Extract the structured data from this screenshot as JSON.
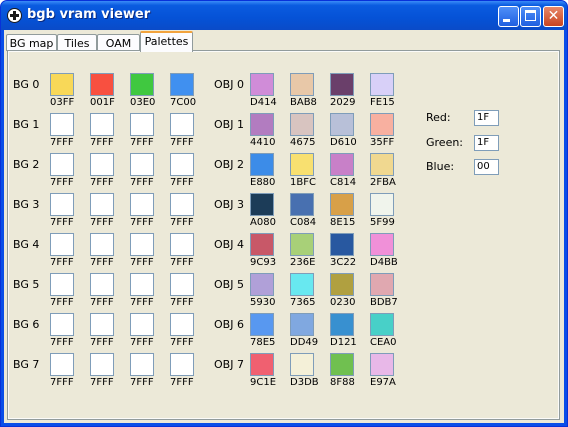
{
  "window": {
    "title": "bgb vram viewer"
  },
  "tabs": [
    {
      "label": "BG map",
      "active": false
    },
    {
      "label": "Tiles",
      "active": false
    },
    {
      "label": "OAM",
      "active": false
    },
    {
      "label": "Palettes",
      "active": true
    }
  ],
  "bg_palettes": [
    {
      "label": "BG 0",
      "colors": [
        {
          "code": "03FF",
          "hex": "#f8d858"
        },
        {
          "code": "001F",
          "hex": "#f85040"
        },
        {
          "code": "03E0",
          "hex": "#40c840"
        },
        {
          "code": "7C00",
          "hex": "#4090f0"
        }
      ]
    },
    {
      "label": "BG 1",
      "colors": [
        {
          "code": "7FFF",
          "hex": "#ffffff"
        },
        {
          "code": "7FFF",
          "hex": "#ffffff"
        },
        {
          "code": "7FFF",
          "hex": "#ffffff"
        },
        {
          "code": "7FFF",
          "hex": "#ffffff"
        }
      ]
    },
    {
      "label": "BG 2",
      "colors": [
        {
          "code": "7FFF",
          "hex": "#ffffff"
        },
        {
          "code": "7FFF",
          "hex": "#ffffff"
        },
        {
          "code": "7FFF",
          "hex": "#ffffff"
        },
        {
          "code": "7FFF",
          "hex": "#ffffff"
        }
      ]
    },
    {
      "label": "BG 3",
      "colors": [
        {
          "code": "7FFF",
          "hex": "#ffffff"
        },
        {
          "code": "7FFF",
          "hex": "#ffffff"
        },
        {
          "code": "7FFF",
          "hex": "#ffffff"
        },
        {
          "code": "7FFF",
          "hex": "#ffffff"
        }
      ]
    },
    {
      "label": "BG 4",
      "colors": [
        {
          "code": "7FFF",
          "hex": "#ffffff"
        },
        {
          "code": "7FFF",
          "hex": "#ffffff"
        },
        {
          "code": "7FFF",
          "hex": "#ffffff"
        },
        {
          "code": "7FFF",
          "hex": "#ffffff"
        }
      ]
    },
    {
      "label": "BG 5",
      "colors": [
        {
          "code": "7FFF",
          "hex": "#ffffff"
        },
        {
          "code": "7FFF",
          "hex": "#ffffff"
        },
        {
          "code": "7FFF",
          "hex": "#ffffff"
        },
        {
          "code": "7FFF",
          "hex": "#ffffff"
        }
      ]
    },
    {
      "label": "BG 6",
      "colors": [
        {
          "code": "7FFF",
          "hex": "#ffffff"
        },
        {
          "code": "7FFF",
          "hex": "#ffffff"
        },
        {
          "code": "7FFF",
          "hex": "#ffffff"
        },
        {
          "code": "7FFF",
          "hex": "#ffffff"
        }
      ]
    },
    {
      "label": "BG 7",
      "colors": [
        {
          "code": "7FFF",
          "hex": "#ffffff"
        },
        {
          "code": "7FFF",
          "hex": "#ffffff"
        },
        {
          "code": "7FFF",
          "hex": "#ffffff"
        },
        {
          "code": "7FFF",
          "hex": "#ffffff"
        }
      ]
    }
  ],
  "obj_palettes": [
    {
      "label": "OBJ 0",
      "colors": [
        {
          "code": "D414",
          "hex": "#d08cd8"
        },
        {
          "code": "BAB8",
          "hex": "#e8c8a8"
        },
        {
          "code": "2029",
          "hex": "#6a3f6a"
        },
        {
          "code": "FE15",
          "hex": "#d8d0f8"
        }
      ]
    },
    {
      "label": "OBJ 1",
      "colors": [
        {
          "code": "4410",
          "hex": "#b27cc0"
        },
        {
          "code": "4675",
          "hex": "#d8c4c0"
        },
        {
          "code": "D610",
          "hex": "#b8c0d8"
        },
        {
          "code": "35FF",
          "hex": "#f8b0a0"
        }
      ]
    },
    {
      "label": "OBJ 2",
      "colors": [
        {
          "code": "E880",
          "hex": "#3c8ce8"
        },
        {
          "code": "1BFC",
          "hex": "#f8e070"
        },
        {
          "code": "C814",
          "hex": "#c880c8"
        },
        {
          "code": "2FBA",
          "hex": "#f0d890"
        }
      ]
    },
    {
      "label": "OBJ 3",
      "colors": [
        {
          "code": "A080",
          "hex": "#1c3c58"
        },
        {
          "code": "C084",
          "hex": "#4870b0"
        },
        {
          "code": "8E15",
          "hex": "#d8a048"
        },
        {
          "code": "5F99",
          "hex": "#f0f4ec"
        }
      ]
    },
    {
      "label": "OBJ 4",
      "colors": [
        {
          "code": "9C93",
          "hex": "#c85868"
        },
        {
          "code": "236E",
          "hex": "#a8d078"
        },
        {
          "code": "3C22",
          "hex": "#2858a0"
        },
        {
          "code": "D4BB",
          "hex": "#f090d8"
        }
      ]
    },
    {
      "label": "OBJ 5",
      "colors": [
        {
          "code": "5930",
          "hex": "#b0a0d8"
        },
        {
          "code": "7365",
          "hex": "#68e8f0"
        },
        {
          "code": "0230",
          "hex": "#b0a040"
        },
        {
          "code": "BDB7",
          "hex": "#e0a8b0"
        }
      ]
    },
    {
      "label": "OBJ 6",
      "colors": [
        {
          "code": "78E5",
          "hex": "#5898f0"
        },
        {
          "code": "DD49",
          "hex": "#80a8e0"
        },
        {
          "code": "D121",
          "hex": "#3890d0"
        },
        {
          "code": "CEA0",
          "hex": "#48d0c8"
        }
      ]
    },
    {
      "label": "OBJ 7",
      "colors": [
        {
          "code": "9C1E",
          "hex": "#f06070"
        },
        {
          "code": "D3DB",
          "hex": "#f4f0d8"
        },
        {
          "code": "8F88",
          "hex": "#70c050"
        },
        {
          "code": "E97A",
          "hex": "#e8b8e8"
        }
      ]
    }
  ],
  "rgb_fields": [
    {
      "label": "Red:",
      "value": "1F"
    },
    {
      "label": "Green:",
      "value": "1F"
    },
    {
      "label": "Blue:",
      "value": "00"
    }
  ]
}
